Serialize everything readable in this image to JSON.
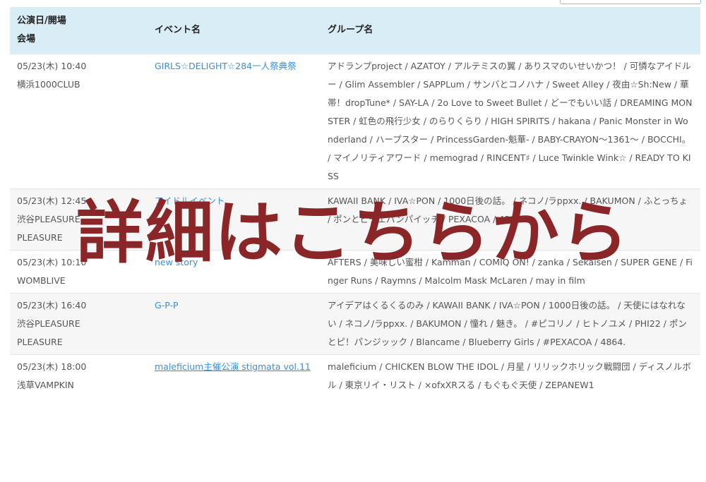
{
  "table": {
    "headers": {
      "date_venue_line1": "公演日/開場",
      "date_venue_line2": "会場",
      "event_name": "イベント名",
      "group_name": "グループ名"
    },
    "rows": [
      {
        "date": "05/23(木) 10:40",
        "venue": "横浜1000CLUB",
        "venue2": "",
        "event": "GIRLS☆DELIGHT☆284一人祭典祭",
        "event_underlined": false,
        "groups": "アドランプproject / AZATOY / アルテミスの翼 / ありスマのいせいかつ！ / 可憐なアイドルー / Glim Assembler / SAPPLum / サンバとコノハナ / Sweet Alley / 夜由☆Sh:New / 華帯！dropTune* / SAY-LA / 2o Love to Sweet Bullet / どーでもいい話 / DREAMING MONSTER / 虹色の飛行少女 / のらりくらり / HIGH SPIRITS / hakana / Panic Monster in Wonderland / ハープスター / PrincessGarden-魁華- / BABY-CRAYON～1361～ / BOCCHI。 / マイノリティアワード / memograd / RINCENT♯ / Luce Twinkle Wink☆ / READY TO KISS"
      },
      {
        "date": "05/23(木) 12:45",
        "venue": "渋谷PLEASURE",
        "venue2": "PLEASURE",
        "event": "アイドルイベント",
        "event_underlined": false,
        "groups": "KAWAII BANK / IVA☆PON / 1000日後の話。 / ネコノ/ラppxx. / BAKUMON / ふとっちょ / ポンとピチェパンパイッチ / PEXACOA / 4864."
      },
      {
        "date": "05/23(木) 10:10",
        "venue": "WOMBLIVE",
        "venue2": "",
        "event": "new story",
        "event_underlined": false,
        "groups": "AFTERS / 美味しい蜜柑 / Kamman / COMIQ ON! / zanka / Sekaisen / SUPER GENE / Finger Runs / Raymns / Malcolm Mask McLaren / may in film"
      },
      {
        "date": "05/23(木) 16:40",
        "venue": "渋谷PLEASURE",
        "venue2": "PLEASURE",
        "event": "G-P-P",
        "event_underlined": false,
        "groups": "アイデアはくるくるのみ / KAWAII BANK / IVA☆PON / 1000日後の話。 / 天使にはなれない / ネコノ/ラppxx. / BAKUMON / 憧れ / 魅き。 / #ピコリノ / ヒトノユメ / PHI22 / ポンとピ！パンジッック / Blancame / Blueberry Girls / #PEXACOA / 4864."
      },
      {
        "date": "05/23(木) 18:00",
        "venue": "浅草VAMPKIN",
        "venue2": "",
        "event": "maleficium主催公演 stigmata vol.11",
        "event_underlined": true,
        "groups": "maleficium / CHICKEN BLOW THE IDOL / 月星 / リリックホリック戦闘団 / ディスノルボル / 東京リイ・リスト / ×ofxXRスる / もぐもぐ天使 / ZEPANEW1"
      }
    ]
  },
  "overlay": {
    "text": "詳細はこちらから"
  },
  "colors": {
    "header_bg": "#d9edf7",
    "link": "#3a8fd9",
    "overlay_text": "#8b2628",
    "alt_row_bg": "#f6f6f6"
  }
}
